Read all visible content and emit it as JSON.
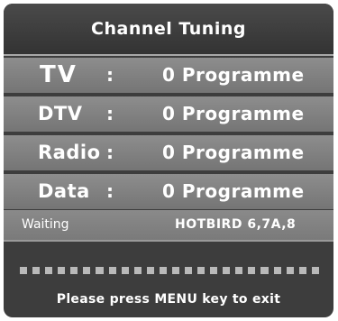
{
  "title": "Channel Tuning",
  "rows": [
    {
      "label": "TV",
      "colon": ":",
      "value": "0 Programme"
    },
    {
      "label": "DTV",
      "colon": ":",
      "value": "0 Programme"
    },
    {
      "label": "Radio",
      "colon": ":",
      "value": "0 Programme"
    },
    {
      "label": "Data",
      "colon": ":",
      "value": "0 Programme"
    }
  ],
  "status": {
    "label": "Waiting",
    "satellite": "HOTBIRD 6,7A,8"
  },
  "progress": {
    "segments": 24
  },
  "hint": "Please press MENU key to exit"
}
